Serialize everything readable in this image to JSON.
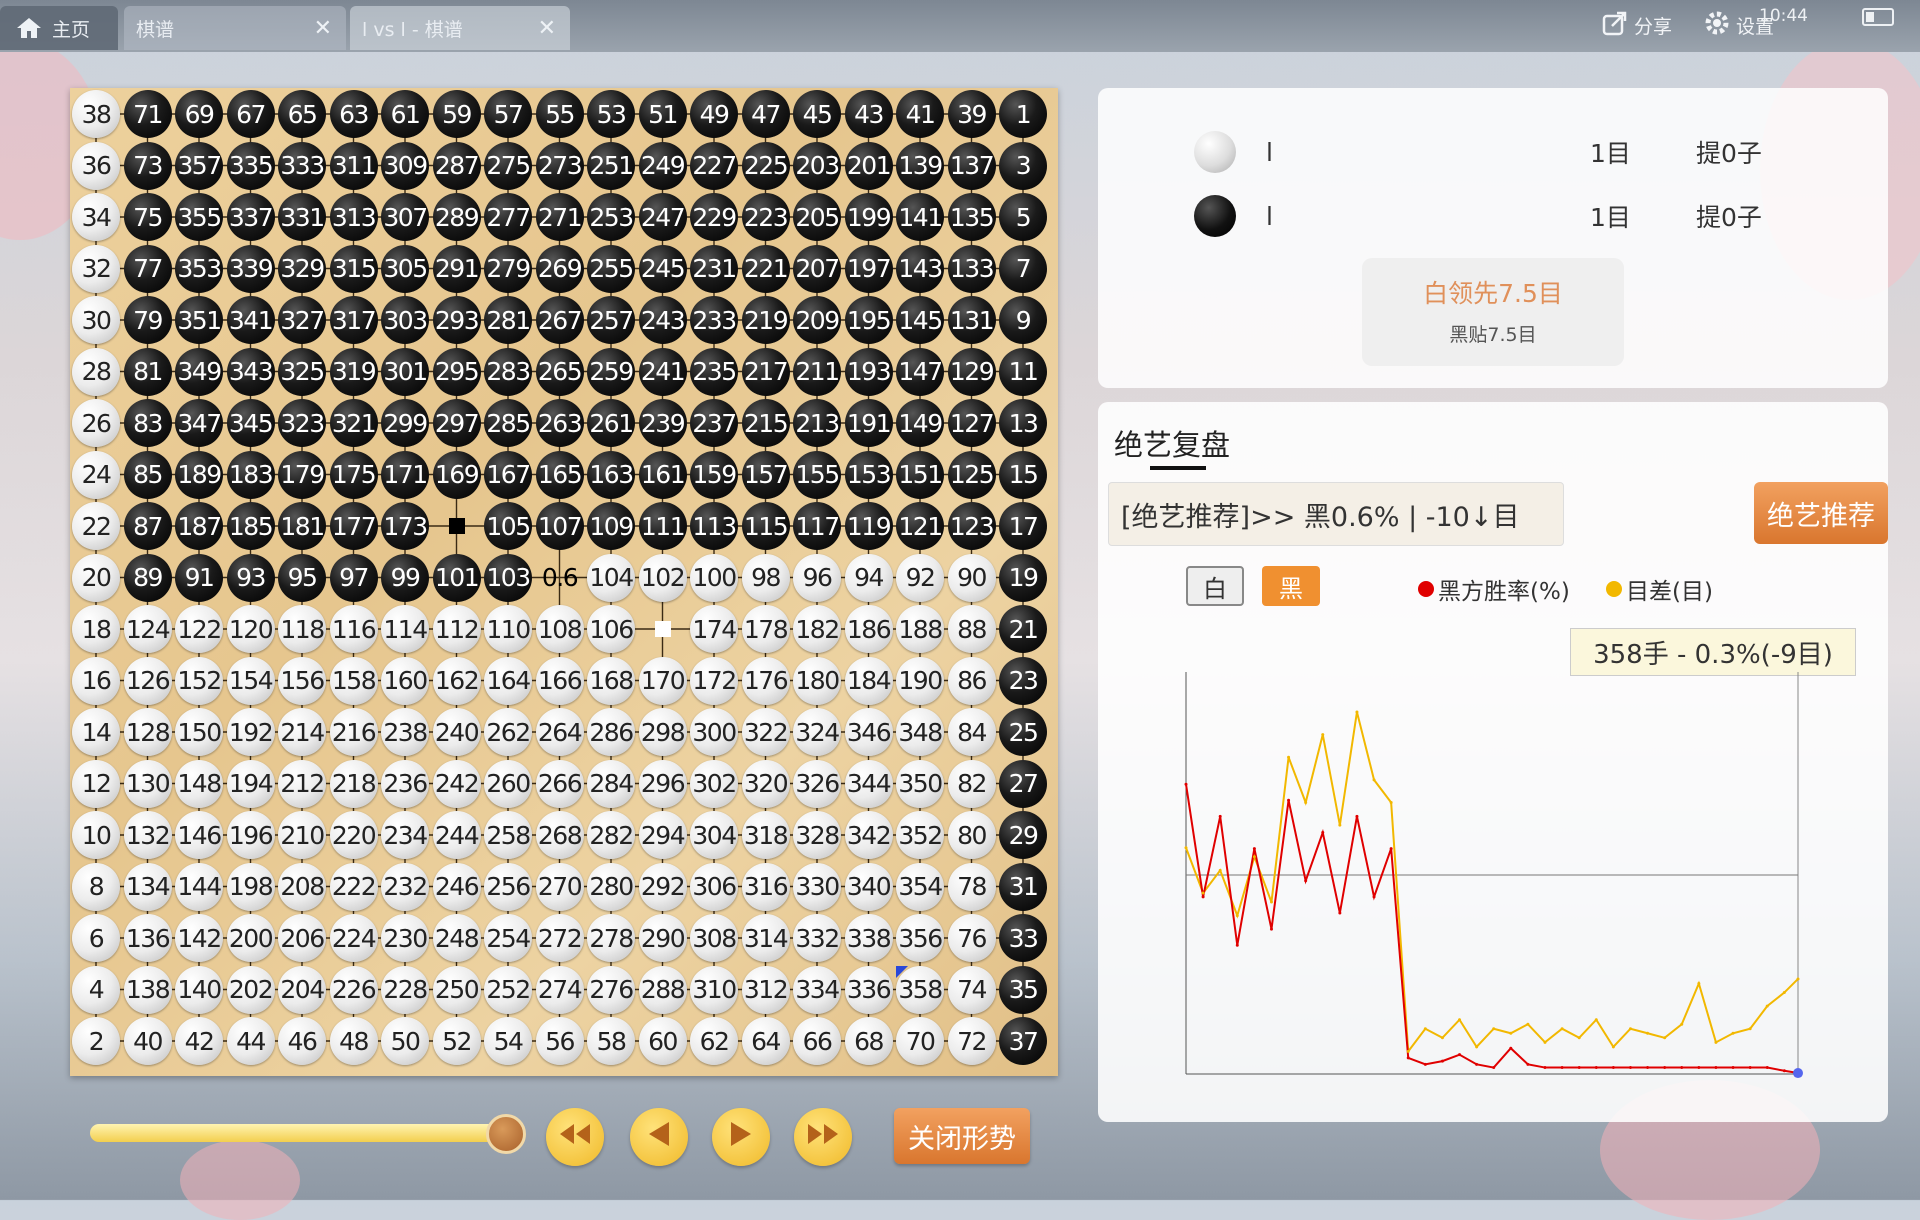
{
  "tabs": [
    {
      "label": "主页"
    },
    {
      "label": "棋谱"
    },
    {
      "label": "l vs l - 棋谱"
    }
  ],
  "topbar": {
    "share_label": "分享",
    "settings_label": "设置",
    "clock": "10:44"
  },
  "board": {
    "size": 19,
    "rows": [
      [
        "w:38",
        "b:71",
        "b:69",
        "b:67",
        "b:65",
        "b:63",
        "b:61",
        "b:59",
        "b:57",
        "b:55",
        "b:53",
        "b:51",
        "b:49",
        "b:47",
        "b:45",
        "b:43",
        "b:41",
        "b:39",
        "b:1"
      ],
      [
        "w:36",
        "b:73",
        "b:357",
        "b:335",
        "b:333",
        "b:311",
        "b:309",
        "b:287",
        "b:275",
        "b:273",
        "b:251",
        "b:249",
        "b:227",
        "b:225",
        "b:203",
        "b:201",
        "b:139",
        "b:137",
        "b:3"
      ],
      [
        "w:34",
        "b:75",
        "b:355",
        "b:337",
        "b:331",
        "b:313",
        "b:307",
        "b:289",
        "b:277",
        "b:271",
        "b:253",
        "b:247",
        "b:229",
        "b:223",
        "b:205",
        "b:199",
        "b:141",
        "b:135",
        "b:5"
      ],
      [
        "w:32",
        "b:77",
        "b:353",
        "b:339",
        "b:329",
        "b:315",
        "b:305",
        "b:291",
        "b:279",
        "b:269",
        "b:255",
        "b:245",
        "b:231",
        "b:221",
        "b:207",
        "b:197",
        "b:143",
        "b:133",
        "b:7"
      ],
      [
        "w:30",
        "b:79",
        "b:351",
        "b:341",
        "b:327",
        "b:317",
        "b:303",
        "b:293",
        "b:281",
        "b:267",
        "b:257",
        "b:243",
        "b:233",
        "b:219",
        "b:209",
        "b:195",
        "b:145",
        "b:131",
        "b:9"
      ],
      [
        "w:28",
        "b:81",
        "b:349",
        "b:343",
        "b:325",
        "b:319",
        "b:301",
        "b:295",
        "b:283",
        "b:265",
        "b:259",
        "b:241",
        "b:235",
        "b:217",
        "b:211",
        "b:193",
        "b:147",
        "b:129",
        "b:11"
      ],
      [
        "w:26",
        "b:83",
        "b:347",
        "b:345",
        "b:323",
        "b:321",
        "b:299",
        "b:297",
        "b:285",
        "b:263",
        "b:261",
        "b:239",
        "b:237",
        "b:215",
        "b:213",
        "b:191",
        "b:149",
        "b:127",
        "b:13"
      ],
      [
        "w:24",
        "b:85",
        "b:189",
        "b:183",
        "b:179",
        "b:175",
        "b:171",
        "b:169",
        "b:167",
        "b:165",
        "b:163",
        "b:161",
        "b:159",
        "b:157",
        "b:155",
        "b:153",
        "b:151",
        "b:125",
        "b:15"
      ],
      [
        "w:22",
        "b:87",
        "b:187",
        "b:185",
        "b:181",
        "b:177",
        "b:173",
        "mb",
        "b:105",
        "b:107",
        "b:109",
        "b:111",
        "b:113",
        "b:115",
        "b:117",
        "b:119",
        "b:121",
        "b:123",
        "b:17"
      ],
      [
        "w:20",
        "b:89",
        "b:91",
        "b:93",
        "b:95",
        "b:97",
        "b:99",
        "b:101",
        "b:103",
        "h:0.6",
        "w:104",
        "w:102",
        "w:100",
        "w:98",
        "w:96",
        "w:94",
        "w:92",
        "w:90",
        "b:19"
      ],
      [
        "w:18",
        "w:124",
        "w:122",
        "w:120",
        "w:118",
        "w:116",
        "w:114",
        "w:112",
        "w:110",
        "w:108",
        "w:106",
        "mw",
        "w:174",
        "w:178",
        "w:182",
        "w:186",
        "w:188",
        "w:88",
        "b:21"
      ],
      [
        "w:16",
        "w:126",
        "w:152",
        "w:154",
        "w:156",
        "w:158",
        "w:160",
        "w:162",
        "w:164",
        "w:166",
        "w:168",
        "w:170",
        "w:172",
        "w:176",
        "w:180",
        "w:184",
        "w:190",
        "w:86",
        "b:23"
      ],
      [
        "w:14",
        "w:128",
        "w:150",
        "w:192",
        "w:214",
        "w:216",
        "w:238",
        "w:240",
        "w:262",
        "w:264",
        "w:286",
        "w:298",
        "w:300",
        "w:322",
        "w:324",
        "w:346",
        "w:348",
        "w:84",
        "b:25"
      ],
      [
        "w:12",
        "w:130",
        "w:148",
        "w:194",
        "w:212",
        "w:218",
        "w:236",
        "w:242",
        "w:260",
        "w:266",
        "w:284",
        "w:296",
        "w:302",
        "w:320",
        "w:326",
        "w:344",
        "w:350",
        "w:82",
        "b:27"
      ],
      [
        "w:10",
        "w:132",
        "w:146",
        "w:196",
        "w:210",
        "w:220",
        "w:234",
        "w:244",
        "w:258",
        "w:268",
        "w:282",
        "w:294",
        "w:304",
        "w:318",
        "w:328",
        "w:342",
        "w:352",
        "w:80",
        "b:29"
      ],
      [
        "w:8",
        "w:134",
        "w:144",
        "w:198",
        "w:208",
        "w:222",
        "w:232",
        "w:246",
        "w:256",
        "w:270",
        "w:280",
        "w:292",
        "w:306",
        "w:316",
        "w:330",
        "w:340",
        "w:354",
        "w:78",
        "b:31"
      ],
      [
        "w:6",
        "w:136",
        "w:142",
        "w:200",
        "w:206",
        "w:224",
        "w:230",
        "w:248",
        "w:254",
        "w:272",
        "w:278",
        "w:290",
        "w:308",
        "w:314",
        "w:332",
        "w:338",
        "w:356",
        "w:76",
        "b:33"
      ],
      [
        "w:4",
        "w:138",
        "w:140",
        "w:202",
        "w:204",
        "w:226",
        "w:228",
        "w:250",
        "w:252",
        "w:274",
        "w:276",
        "w:288",
        "w:310",
        "w:312",
        "w:334",
        "w:336",
        "w:358",
        "w:74",
        "b:35"
      ],
      [
        "w:2",
        "w:40",
        "w:42",
        "w:44",
        "w:46",
        "w:48",
        "w:50",
        "w:52",
        "w:54",
        "w:56",
        "w:58",
        "w:60",
        "w:62",
        "w:64",
        "w:66",
        "w:68",
        "w:70",
        "w:72",
        "b:37"
      ]
    ],
    "last_move_marker": "358"
  },
  "players": [
    {
      "color": "white",
      "name": "l",
      "territory": "1目",
      "captures": "提0子"
    },
    {
      "color": "black",
      "name": "l",
      "territory": "1目",
      "captures": "提0子"
    }
  ],
  "lead": {
    "main": "白领先7.5目",
    "komi": "黑贴7.5目"
  },
  "analysis": {
    "title": "绝艺复盘",
    "recommendation": "[绝艺推荐]>> 黑0.6% | -10↓目",
    "recommend_button": "绝艺推荐",
    "toggle_white": "白",
    "toggle_black": "黑",
    "legend_winrate": "黑方胜率(%)",
    "legend_margin": "目差(目)",
    "tooltip": "358手 - 0.3%(-9目)"
  },
  "controls": {
    "close_form_label": "关闭形势",
    "progress": 1.0
  },
  "colors": {
    "winrate": "#e00000",
    "margin": "#f2b800",
    "accent": "#e07a35"
  },
  "chart_data": {
    "type": "line",
    "x_range": [
      0,
      358
    ],
    "series": [
      {
        "name": "黑方胜率(%)",
        "x": [
          0,
          10,
          20,
          30,
          40,
          50,
          60,
          70,
          80,
          90,
          100,
          110,
          120,
          130,
          140,
          150,
          160,
          170,
          180,
          190,
          200,
          210,
          220,
          230,
          240,
          250,
          260,
          270,
          280,
          290,
          300,
          310,
          320,
          330,
          340,
          350,
          358
        ],
        "values": [
          90,
          55,
          80,
          40,
          70,
          45,
          85,
          60,
          75,
          50,
          80,
          55,
          70,
          5,
          3,
          4,
          6,
          3,
          2,
          8,
          3,
          2,
          2,
          2,
          2,
          2,
          2,
          2,
          2,
          2,
          2,
          2,
          2,
          2,
          2,
          1,
          0.3
        ]
      },
      {
        "name": "目差(目)",
        "x": [
          0,
          10,
          20,
          30,
          40,
          50,
          60,
          70,
          80,
          90,
          100,
          110,
          120,
          130,
          140,
          150,
          160,
          170,
          180,
          190,
          200,
          210,
          220,
          230,
          240,
          250,
          260,
          270,
          280,
          290,
          300,
          310,
          320,
          330,
          340,
          350,
          358
        ],
        "values": [
          20,
          10,
          15,
          5,
          18,
          8,
          40,
          30,
          45,
          25,
          50,
          35,
          30,
          -25,
          -20,
          -22,
          -18,
          -24,
          -20,
          -21,
          -19,
          -23,
          -20,
          -22,
          -18,
          -24,
          -20,
          -21,
          -22,
          -19,
          -10,
          -23,
          -21,
          -20,
          -15,
          -12,
          -9
        ]
      }
    ]
  }
}
